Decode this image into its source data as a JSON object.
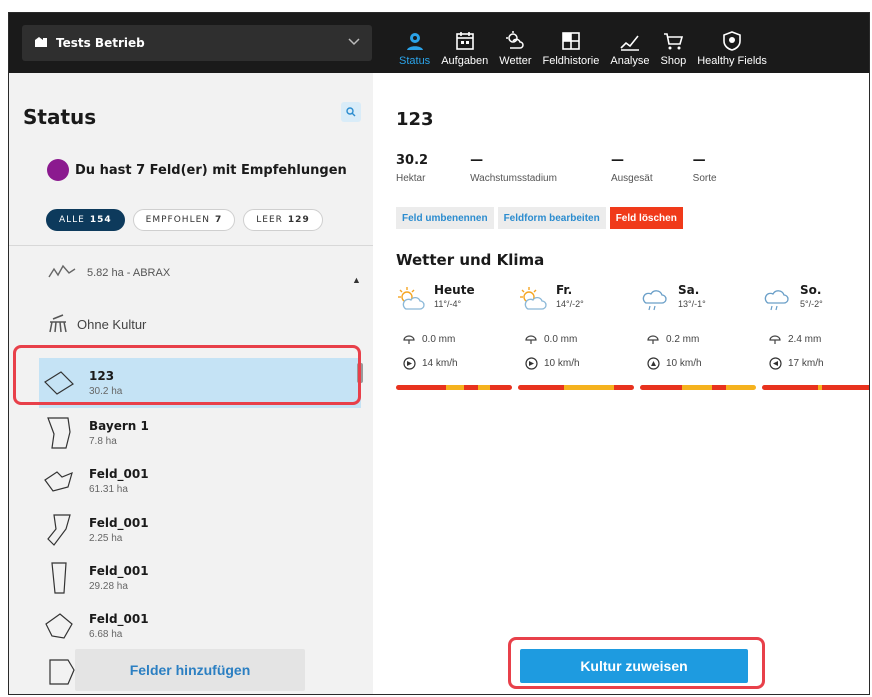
{
  "header": {
    "farm_name": "Tests Betrieb",
    "nav": [
      {
        "label": "Status",
        "icon": "status-icon",
        "active": true
      },
      {
        "label": "Aufgaben",
        "icon": "calendar-icon"
      },
      {
        "label": "Wetter",
        "icon": "weather-icon"
      },
      {
        "label": "Feldhistorie",
        "icon": "field-history-icon"
      },
      {
        "label": "Analyse",
        "icon": "analysis-icon"
      },
      {
        "label": "Shop",
        "icon": "cart-icon"
      },
      {
        "label": "Healthy Fields",
        "icon": "shield-icon"
      }
    ]
  },
  "sidebar": {
    "title": "Status",
    "recommendation": "Du hast 7 Feld(er) mit Empfehlungen",
    "filters": [
      {
        "label": "ALLE",
        "count": "154",
        "active": true
      },
      {
        "label": "EMPFOHLEN",
        "count": "7"
      },
      {
        "label": "LEER",
        "count": "129"
      }
    ],
    "group_abrax": "5.82 ha - ABRAX",
    "group_no_crop": "Ohne Kultur",
    "fields": [
      {
        "name": "123",
        "area": "30.2 ha"
      },
      {
        "name": "Bayern 1",
        "area": "7.8 ha"
      },
      {
        "name": "Feld_001",
        "area": "61.31 ha"
      },
      {
        "name": "Feld_001",
        "area": "2.25 ha"
      },
      {
        "name": "Feld_001",
        "area": "29.28 ha"
      },
      {
        "name": "Feld_001",
        "area": "6.68 ha"
      }
    ],
    "add_fields_label": "Felder hinzufügen"
  },
  "main": {
    "field_title": "123",
    "stats": [
      {
        "value": "30.2",
        "label": "Hektar"
      },
      {
        "value": "—",
        "label": "Wachstumsstadium"
      },
      {
        "value": "—",
        "label": "Ausgesät"
      },
      {
        "value": "—",
        "label": "Sorte"
      }
    ],
    "actions": {
      "rename": "Feld umbenennen",
      "edit_shape": "Feldform bearbeiten",
      "delete": "Feld löschen"
    },
    "weather_title": "Wetter und Klima",
    "days": [
      {
        "name": "Heute",
        "temp": "11°/-4°",
        "icon": "sun-cloud-icon",
        "rain": "0.0 mm",
        "wind": "14 km/h"
      },
      {
        "name": "Fr.",
        "temp": "14°/-2°",
        "icon": "sun-cloud-icon",
        "rain": "0.0 mm",
        "wind": "10 km/h"
      },
      {
        "name": "Sa.",
        "temp": "13°/-1°",
        "icon": "rain-cloud-icon",
        "rain": "0.2 mm",
        "wind": "10 km/h"
      },
      {
        "name": "So.",
        "temp": "5°/-2°",
        "icon": "rain-cloud-icon",
        "rain": "2.4 mm",
        "wind": "17 km/h"
      }
    ],
    "assign_label": "Kultur zuweisen"
  },
  "colors": {
    "accent": "#1e9be0",
    "danger": "#f03a1a",
    "highlight": "#e8404a",
    "bar_red": "#e8321e",
    "bar_yellow": "#f5b21e"
  }
}
